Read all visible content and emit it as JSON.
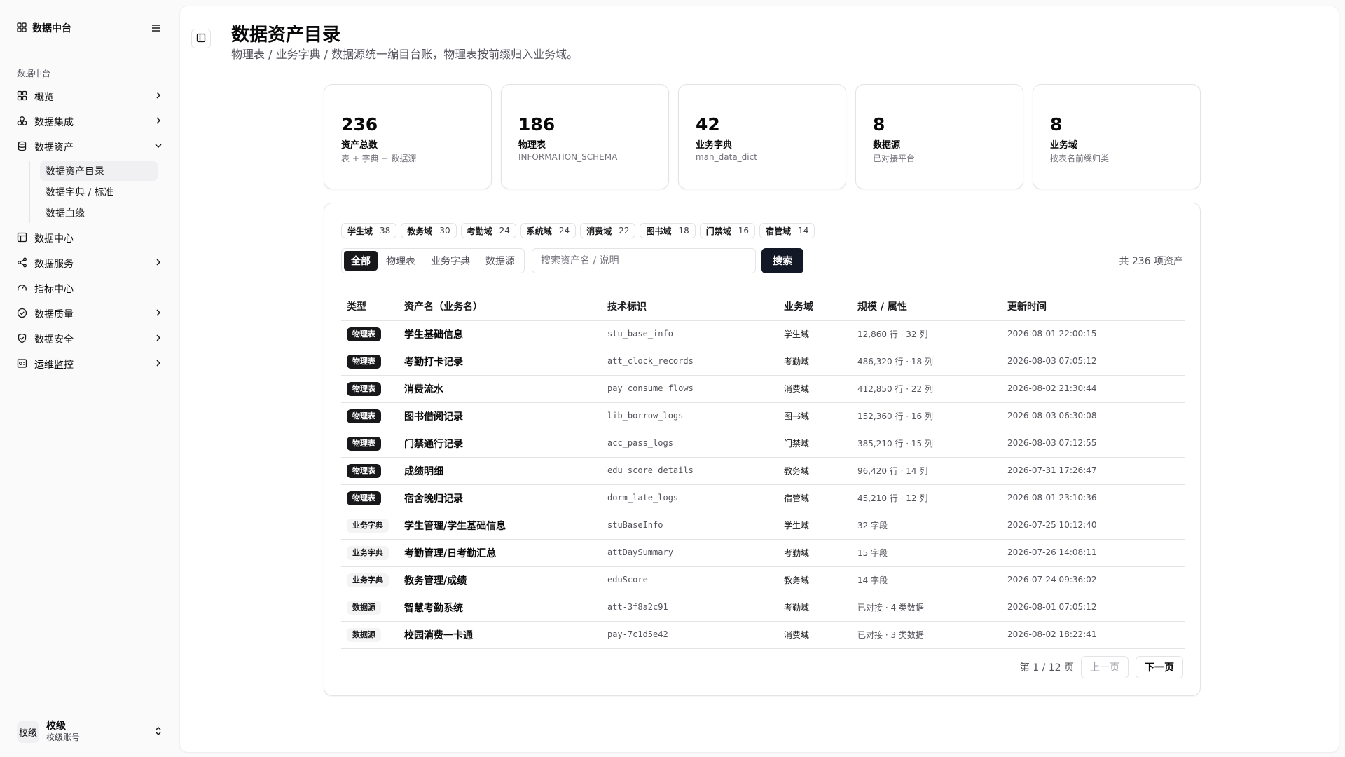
{
  "app": {
    "name": "数据中台"
  },
  "sidebar": {
    "group_label": "数据中台",
    "items": [
      {
        "label": "概览",
        "icon": "grid-icon",
        "has_chevron": true
      },
      {
        "label": "数据集成",
        "icon": "boxes-icon",
        "has_chevron": true
      },
      {
        "label": "数据资产",
        "icon": "database-icon",
        "has_chevron": true,
        "expanded": true
      },
      {
        "label": "数据中心",
        "icon": "table-icon",
        "has_chevron": false
      },
      {
        "label": "数据服务",
        "icon": "share-icon",
        "has_chevron": true
      },
      {
        "label": "指标中心",
        "icon": "gauge-icon",
        "has_chevron": false
      },
      {
        "label": "数据质量",
        "icon": "check-circle-icon",
        "has_chevron": true
      },
      {
        "label": "数据安全",
        "icon": "shield-icon",
        "has_chevron": true
      },
      {
        "label": "运维监控",
        "icon": "monitor-icon",
        "has_chevron": true
      }
    ],
    "subitems": [
      {
        "label": "数据资产目录",
        "active": true
      },
      {
        "label": "数据字典 / 标准",
        "active": false
      },
      {
        "label": "数据血缘",
        "active": false
      }
    ],
    "user": {
      "avatar": "校级",
      "name": "校级",
      "sub": "校级账号"
    }
  },
  "header": {
    "title": "数据资产目录",
    "subtitle": "物理表 / 业务字典 / 数据源统一编目台账，物理表按前缀归入业务域。"
  },
  "stats": [
    {
      "value": "236",
      "label": "资产总数",
      "sub": "表 + 字典 + 数据源"
    },
    {
      "value": "186",
      "label": "物理表",
      "sub": "INFORMATION_SCHEMA"
    },
    {
      "value": "42",
      "label": "业务字典",
      "sub": "man_data_dict"
    },
    {
      "value": "8",
      "label": "数据源",
      "sub": "已对接平台"
    },
    {
      "value": "8",
      "label": "业务域",
      "sub": "按表名前缀归类"
    }
  ],
  "domain_chips": [
    {
      "name": "学生域",
      "count": "38"
    },
    {
      "name": "教务域",
      "count": "30"
    },
    {
      "name": "考勤域",
      "count": "24"
    },
    {
      "name": "系统域",
      "count": "24"
    },
    {
      "name": "消费域",
      "count": "22"
    },
    {
      "name": "图书域",
      "count": "18"
    },
    {
      "name": "门禁域",
      "count": "16"
    },
    {
      "name": "宿管域",
      "count": "14"
    }
  ],
  "filter": {
    "tabs": [
      "全部",
      "物理表",
      "业务字典",
      "数据源"
    ],
    "active_tab": "全部",
    "search_placeholder": "搜索资产名 / 说明",
    "search_value": "",
    "search_button": "搜索",
    "total": "共 236 项资产"
  },
  "table": {
    "columns": [
      "类型",
      "资产名（业务名）",
      "技术标识",
      "业务域",
      "规模 / 属性",
      "更新时间"
    ],
    "rows": [
      {
        "type": "物理表",
        "name": "学生基础信息",
        "code": "stu_base_info",
        "domain": "学生域",
        "scale": "12,860 行 · 32 列",
        "time": "2026-08-01 22:00:15"
      },
      {
        "type": "物理表",
        "name": "考勤打卡记录",
        "code": "att_clock_records",
        "domain": "考勤域",
        "scale": "486,320 行 · 18 列",
        "time": "2026-08-03 07:05:12"
      },
      {
        "type": "物理表",
        "name": "消费流水",
        "code": "pay_consume_flows",
        "domain": "消费域",
        "scale": "412,850 行 · 22 列",
        "time": "2026-08-02 21:30:44"
      },
      {
        "type": "物理表",
        "name": "图书借阅记录",
        "code": "lib_borrow_logs",
        "domain": "图书域",
        "scale": "152,360 行 · 16 列",
        "time": "2026-08-03 06:30:08"
      },
      {
        "type": "物理表",
        "name": "门禁通行记录",
        "code": "acc_pass_logs",
        "domain": "门禁域",
        "scale": "385,210 行 · 15 列",
        "time": "2026-08-03 07:12:55"
      },
      {
        "type": "物理表",
        "name": "成绩明细",
        "code": "edu_score_details",
        "domain": "教务域",
        "scale": "96,420 行 · 14 列",
        "time": "2026-07-31 17:26:47"
      },
      {
        "type": "物理表",
        "name": "宿舍晚归记录",
        "code": "dorm_late_logs",
        "domain": "宿管域",
        "scale": "45,210 行 · 12 列",
        "time": "2026-08-01 23:10:36"
      },
      {
        "type": "业务字典",
        "name": "学生管理/学生基础信息",
        "code": "stuBaseInfo",
        "domain": "学生域",
        "scale": "32 字段",
        "time": "2026-07-25 10:12:40"
      },
      {
        "type": "业务字典",
        "name": "考勤管理/日考勤汇总",
        "code": "attDaySummary",
        "domain": "考勤域",
        "scale": "15 字段",
        "time": "2026-07-26 14:08:11"
      },
      {
        "type": "业务字典",
        "name": "教务管理/成绩",
        "code": "eduScore",
        "domain": "教务域",
        "scale": "14 字段",
        "time": "2026-07-24 09:36:02"
      },
      {
        "type": "数据源",
        "name": "智慧考勤系统",
        "code": "att-3f8a2c91",
        "domain": "考勤域",
        "scale": "已对接 · 4 类数据",
        "time": "2026-08-01 07:05:12"
      },
      {
        "type": "数据源",
        "name": "校园消费一卡通",
        "code": "pay-7c1d5e42",
        "domain": "消费域",
        "scale": "已对接 · 3 类数据",
        "time": "2026-08-02 18:22:41"
      }
    ]
  },
  "pager": {
    "info": "第 1 / 12 页",
    "prev": "上一页",
    "next": "下一页"
  },
  "colors": {
    "primary": "#121826",
    "badge_dark": "#18181b",
    "badge_light": "#f4f4f5",
    "border": "#e4e4e7",
    "muted_text": "#52525b"
  }
}
